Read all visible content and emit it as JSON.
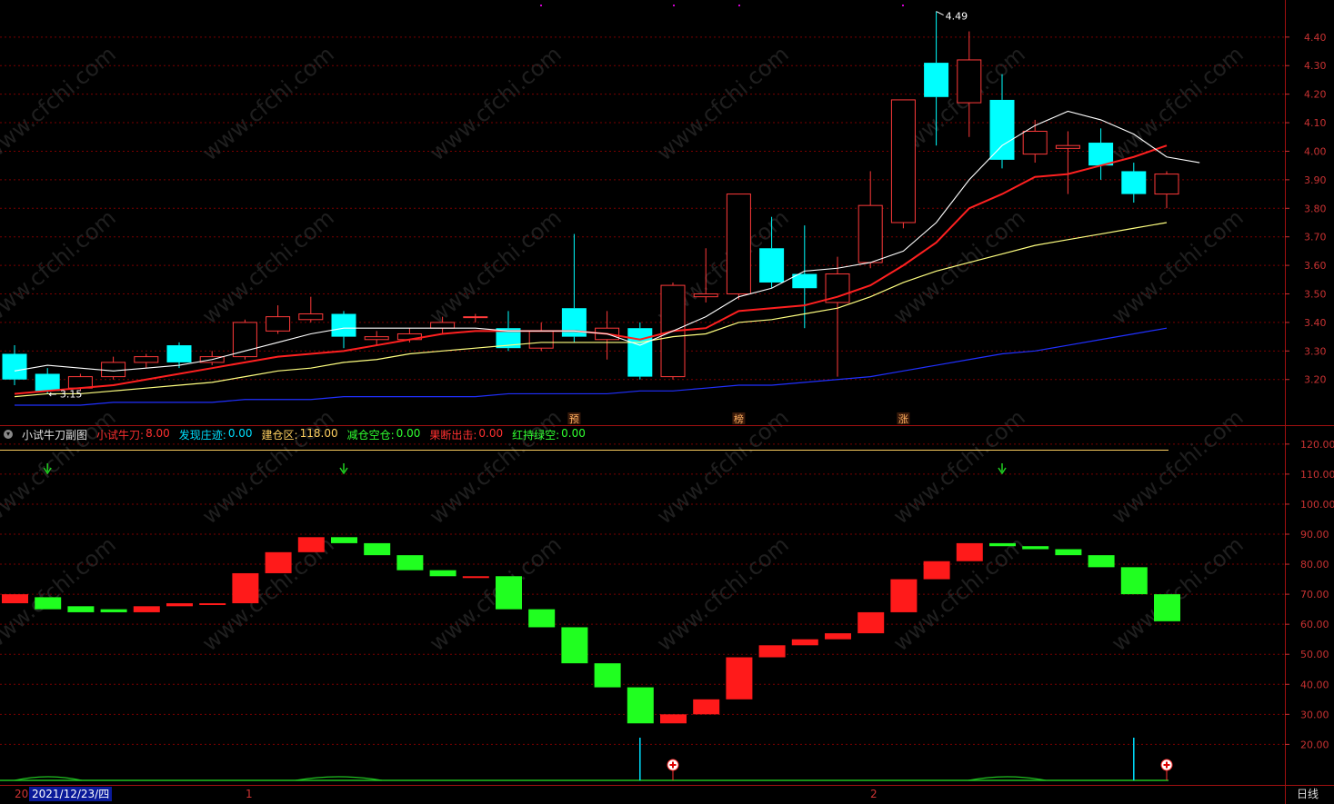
{
  "colors": {
    "up": "#ff3a3a",
    "down": "#00ffff",
    "grid": "#7a0000",
    "axis_text": "#c83232",
    "ma5": "#ffffff",
    "ma10": "#ff2020",
    "ma20": "#ffff80",
    "ma60": "#2030ff",
    "sub_up": "#ff1a1a",
    "sub_down": "#20ff20",
    "sub_line": "#ffd060",
    "arrow": "#20d020"
  },
  "chart_data": [
    {
      "type": "candlestick",
      "yticks": [
        "4.40",
        "4.30",
        "4.20",
        "4.10",
        "4.00",
        "3.90",
        "3.80",
        "3.70",
        "3.60",
        "3.50",
        "3.40",
        "3.30",
        "3.20"
      ],
      "ylim": [
        3.04,
        4.53
      ],
      "candles": [
        {
          "o": 3.29,
          "c": 3.2,
          "h": 3.32,
          "l": 3.18
        },
        {
          "o": 3.22,
          "c": 3.16,
          "h": 3.24,
          "l": 3.15
        },
        {
          "o": 3.17,
          "c": 3.21,
          "h": 3.22,
          "l": 3.16
        },
        {
          "o": 3.21,
          "c": 3.26,
          "h": 3.28,
          "l": 3.2
        },
        {
          "o": 3.26,
          "c": 3.28,
          "h": 3.29,
          "l": 3.24
        },
        {
          "o": 3.32,
          "c": 3.26,
          "h": 3.33,
          "l": 3.24
        },
        {
          "o": 3.26,
          "c": 3.28,
          "h": 3.3,
          "l": 3.25
        },
        {
          "o": 3.28,
          "c": 3.4,
          "h": 3.41,
          "l": 3.27
        },
        {
          "o": 3.37,
          "c": 3.42,
          "h": 3.46,
          "l": 3.36
        },
        {
          "o": 3.41,
          "c": 3.43,
          "h": 3.49,
          "l": 3.4
        },
        {
          "o": 3.43,
          "c": 3.35,
          "h": 3.44,
          "l": 3.31
        },
        {
          "o": 3.34,
          "c": 3.35,
          "h": 3.37,
          "l": 3.32
        },
        {
          "o": 3.34,
          "c": 3.36,
          "h": 3.38,
          "l": 3.33
        },
        {
          "o": 3.38,
          "c": 3.4,
          "h": 3.42,
          "l": 3.36
        },
        {
          "o": 3.42,
          "c": 3.42,
          "h": 3.43,
          "l": 3.4
        },
        {
          "o": 3.38,
          "c": 3.31,
          "h": 3.44,
          "l": 3.3
        },
        {
          "o": 3.31,
          "c": 3.37,
          "h": 3.4,
          "l": 3.3
        },
        {
          "o": 3.45,
          "c": 3.35,
          "h": 3.71,
          "l": 3.33
        },
        {
          "o": 3.34,
          "c": 3.38,
          "h": 3.44,
          "l": 3.27
        },
        {
          "o": 3.38,
          "c": 3.21,
          "h": 3.4,
          "l": 3.2
        },
        {
          "o": 3.21,
          "c": 3.53,
          "h": 3.54,
          "l": 3.2
        },
        {
          "o": 3.49,
          "c": 3.5,
          "h": 3.66,
          "l": 3.47
        },
        {
          "o": 3.5,
          "c": 3.85,
          "h": 3.85,
          "l": 3.48
        },
        {
          "o": 3.66,
          "c": 3.54,
          "h": 3.77,
          "l": 3.52
        },
        {
          "o": 3.57,
          "c": 3.52,
          "h": 3.74,
          "l": 3.38
        },
        {
          "o": 3.47,
          "c": 3.57,
          "h": 3.63,
          "l": 3.21
        },
        {
          "o": 3.61,
          "c": 3.81,
          "h": 3.93,
          "l": 3.59
        },
        {
          "o": 3.75,
          "c": 4.18,
          "h": 4.18,
          "l": 3.73
        },
        {
          "o": 4.31,
          "c": 4.19,
          "h": 4.49,
          "l": 4.02
        },
        {
          "o": 4.17,
          "c": 4.32,
          "h": 4.42,
          "l": 4.05
        },
        {
          "o": 4.18,
          "c": 3.97,
          "h": 4.27,
          "l": 3.94
        },
        {
          "o": 3.99,
          "c": 4.07,
          "h": 4.11,
          "l": 3.96
        },
        {
          "o": 4.01,
          "c": 4.02,
          "h": 4.07,
          "l": 3.85
        },
        {
          "o": 4.03,
          "c": 3.95,
          "h": 4.08,
          "l": 3.9
        },
        {
          "o": 3.93,
          "c": 3.85,
          "h": 3.96,
          "l": 3.82
        },
        {
          "o": 3.85,
          "c": 3.92,
          "h": 3.93,
          "l": 3.8
        }
      ],
      "ma5": [
        3.23,
        3.25,
        3.24,
        3.23,
        3.24,
        3.25,
        3.27,
        3.3,
        3.33,
        3.36,
        3.38,
        3.38,
        3.38,
        3.38,
        3.38,
        3.37,
        3.37,
        3.37,
        3.36,
        3.32,
        3.37,
        3.42,
        3.49,
        3.52,
        3.58,
        3.59,
        3.61,
        3.65,
        3.75,
        3.9,
        4.02,
        4.09,
        4.14,
        4.11,
        4.06,
        3.98,
        3.96
      ],
      "ma10": [
        3.15,
        3.16,
        3.17,
        3.18,
        3.2,
        3.22,
        3.24,
        3.26,
        3.28,
        3.29,
        3.3,
        3.32,
        3.34,
        3.36,
        3.37,
        3.37,
        3.37,
        3.37,
        3.36,
        3.34,
        3.37,
        3.38,
        3.44,
        3.45,
        3.46,
        3.49,
        3.53,
        3.6,
        3.68,
        3.8,
        3.85,
        3.91,
        3.92,
        3.95,
        3.98,
        4.02
      ],
      "ma20": [
        3.14,
        3.15,
        3.15,
        3.16,
        3.17,
        3.18,
        3.19,
        3.21,
        3.23,
        3.24,
        3.26,
        3.27,
        3.29,
        3.3,
        3.31,
        3.32,
        3.33,
        3.33,
        3.33,
        3.33,
        3.35,
        3.36,
        3.4,
        3.41,
        3.43,
        3.45,
        3.49,
        3.54,
        3.58,
        3.61,
        3.64,
        3.67,
        3.69,
        3.71,
        3.73,
        3.75
      ],
      "ma60": [
        3.11,
        3.11,
        3.11,
        3.12,
        3.12,
        3.12,
        3.12,
        3.13,
        3.13,
        3.13,
        3.14,
        3.14,
        3.14,
        3.14,
        3.14,
        3.15,
        3.15,
        3.15,
        3.15,
        3.16,
        3.16,
        3.17,
        3.18,
        3.18,
        3.19,
        3.2,
        3.21,
        3.23,
        3.25,
        3.27,
        3.29,
        3.3,
        3.32,
        3.34,
        3.36,
        3.38
      ],
      "annotations": {
        "high_label": "4.49",
        "low_label": "3.15"
      },
      "markers": [
        {
          "index": 17,
          "text": "预"
        },
        {
          "index": 22,
          "text": "榜"
        },
        {
          "index": 27,
          "text": "涨"
        }
      ]
    },
    {
      "type": "bar",
      "title": "小试牛刀副图",
      "legend": [
        {
          "label": "小试牛刀:",
          "value": "8.00",
          "color": "#ff3030"
        },
        {
          "label": "发现庄迹:",
          "value": "0.00",
          "color": "#00e0ff"
        },
        {
          "label": "建仓区:",
          "value": "118.00",
          "color": "#ffd060"
        },
        {
          "label": "减仓空仓:",
          "value": "0.00",
          "color": "#30ff30"
        },
        {
          "label": "果断出击:",
          "value": "0.00",
          "color": "#ff3030"
        },
        {
          "label": "红持绿空:",
          "value": "0.00",
          "color": "#30ff30"
        }
      ],
      "yticks": [
        "120.00",
        "110.00",
        "100.00",
        "90.00",
        "80.00",
        "70.00",
        "60.00",
        "50.00",
        "40.00",
        "30.00",
        "20.00"
      ],
      "ylim": [
        6.5,
        126
      ],
      "reference_line": 118,
      "bars": [
        [
          67,
          70
        ],
        [
          69,
          65
        ],
        [
          66,
          64
        ],
        [
          65,
          64
        ],
        [
          64,
          66
        ],
        [
          66,
          67
        ],
        [
          67,
          67
        ],
        [
          67,
          77
        ],
        [
          77,
          84
        ],
        [
          84,
          89
        ],
        [
          89,
          87
        ],
        [
          87,
          83
        ],
        [
          83,
          78
        ],
        [
          78,
          76
        ],
        [
          76,
          76
        ],
        [
          76,
          65
        ],
        [
          65,
          59
        ],
        [
          59,
          47
        ],
        [
          47,
          39
        ],
        [
          39,
          27
        ],
        [
          27,
          30
        ],
        [
          30,
          35
        ],
        [
          35,
          49
        ],
        [
          49,
          53
        ],
        [
          53,
          55
        ],
        [
          55,
          57
        ],
        [
          57,
          64
        ],
        [
          64,
          75
        ],
        [
          75,
          81
        ],
        [
          81,
          87
        ],
        [
          87,
          86
        ],
        [
          86,
          85
        ],
        [
          85,
          83
        ],
        [
          83,
          79
        ],
        [
          79,
          70
        ],
        [
          70,
          61
        ]
      ],
      "down_arrows": [
        1,
        10,
        30
      ],
      "spikes": [
        19,
        34
      ],
      "plus_markers": [
        20,
        35
      ]
    }
  ],
  "xaxis": {
    "left_stub": "20",
    "date": "2021/12/23/四",
    "month_labels": [
      {
        "index": 7,
        "text": "1"
      },
      {
        "index": 26,
        "text": "2"
      }
    ],
    "period": "日线"
  },
  "watermark": "www.cfchi.com"
}
